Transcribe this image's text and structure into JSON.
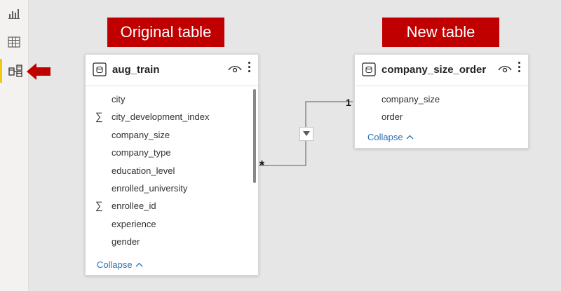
{
  "captions": {
    "original": "Original table",
    "new": "New table"
  },
  "original_table": {
    "name": "aug_train",
    "fields": [
      {
        "name": "city",
        "sigma": false
      },
      {
        "name": "city_development_index",
        "sigma": true
      },
      {
        "name": "company_size",
        "sigma": false
      },
      {
        "name": "company_type",
        "sigma": false
      },
      {
        "name": "education_level",
        "sigma": false
      },
      {
        "name": "enrolled_university",
        "sigma": false
      },
      {
        "name": "enrollee_id",
        "sigma": true
      },
      {
        "name": "experience",
        "sigma": false
      },
      {
        "name": "gender",
        "sigma": false
      }
    ],
    "sigma_symbol": "∑",
    "collapse_label": "Collapse"
  },
  "new_table": {
    "name": "company_size_order",
    "fields": [
      {
        "name": "company_size"
      },
      {
        "name": "order"
      }
    ],
    "collapse_label": "Collapse"
  },
  "relationship": {
    "one_side": "1",
    "many_side": "*"
  },
  "colors": {
    "caption_bg": "#c00000",
    "arrow": "#c00000",
    "link": "#2b6fb6",
    "active_accent": "#f2c811"
  },
  "icons": [
    "report-view-icon",
    "data-view-icon",
    "model-view-icon",
    "table-icon",
    "eye-icon",
    "more-options-icon",
    "chevron-up-icon",
    "filter-direction-icon"
  ]
}
